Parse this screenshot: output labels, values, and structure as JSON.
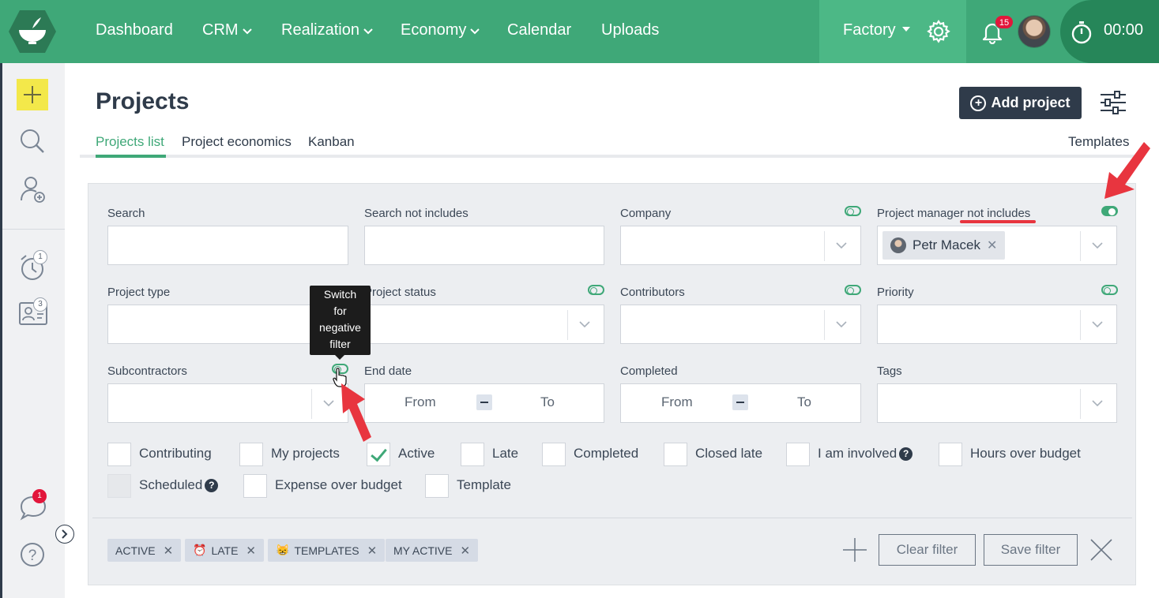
{
  "nav": {
    "items": [
      {
        "label": "Dashboard",
        "dropdown": false
      },
      {
        "label": "CRM",
        "dropdown": true
      },
      {
        "label": "Realization",
        "dropdown": true
      },
      {
        "label": "Economy",
        "dropdown": true
      },
      {
        "label": "Calendar",
        "dropdown": false
      },
      {
        "label": "Uploads",
        "dropdown": false
      }
    ],
    "workspace": "Factory",
    "notifications_count": "15",
    "timer": "00:00"
  },
  "sidebar": {
    "alarm_badge": "1",
    "contacts_badge": "3",
    "chat_badge": "1"
  },
  "header": {
    "title": "Projects",
    "add_project_label": "Add project"
  },
  "tabs": [
    {
      "label": "Projects list",
      "active": true
    },
    {
      "label": "Project economics",
      "active": false
    },
    {
      "label": "Kanban",
      "active": false
    }
  ],
  "templates_link": "Templates",
  "filters": {
    "search": {
      "label": "Search",
      "value": ""
    },
    "search_not_includes": {
      "label": "Search not includes",
      "value": ""
    },
    "company": {
      "label": "Company",
      "negate": false
    },
    "project_manager": {
      "label_start": "Project manager",
      "label_neg": " not includes",
      "negate": true,
      "selected": "Petr Macek"
    },
    "project_type": {
      "label": "Project type"
    },
    "project_status": {
      "label": "Project status",
      "negate": false
    },
    "contributors": {
      "label": "Contributors",
      "negate": false
    },
    "priority": {
      "label": "Priority",
      "negate": false
    },
    "subcontractors": {
      "label": "Subcontractors",
      "negate": false
    },
    "end_date": {
      "label": "End date",
      "from": "From",
      "to": "To"
    },
    "completed": {
      "label": "Completed",
      "from": "From",
      "to": "To"
    },
    "tags": {
      "label": "Tags"
    }
  },
  "tooltip": {
    "line1": "Switch",
    "line2": "for",
    "line3": "negative",
    "line4": "filter"
  },
  "checkboxes": [
    {
      "label": "Contributing",
      "checked": false
    },
    {
      "label": "My projects",
      "checked": false
    },
    {
      "label": "Active",
      "checked": true
    },
    {
      "label": "Late",
      "checked": false
    },
    {
      "label": "Completed",
      "checked": false
    },
    {
      "label": "Closed late",
      "checked": false
    },
    {
      "label": "I am involved",
      "checked": false,
      "help": true
    },
    {
      "label": "Hours over budget",
      "checked": false
    },
    {
      "label": "Scheduled",
      "checked": false,
      "help": true,
      "disabled": true
    },
    {
      "label": "Expense over budget",
      "checked": false
    },
    {
      "label": "Template",
      "checked": false
    }
  ],
  "saved_filters": [
    {
      "label": "ACTIVE",
      "icon": ""
    },
    {
      "label": "LATE",
      "icon": "⏰"
    },
    {
      "label": "TEMPLATES",
      "icon": "😸"
    },
    {
      "label": "MY ACTIVE",
      "icon": ""
    }
  ],
  "actions": {
    "clear_filter": "Clear filter",
    "save_filter": "Save filter"
  },
  "help_glyph": "?",
  "remove_glyph": "✕",
  "colors": {
    "brand_green": "#3fa878",
    "dark": "#2f3b4a",
    "badge_red": "#e2163b",
    "annotation_red": "#e8353f",
    "highlight_yellow": "#f3e84a"
  }
}
